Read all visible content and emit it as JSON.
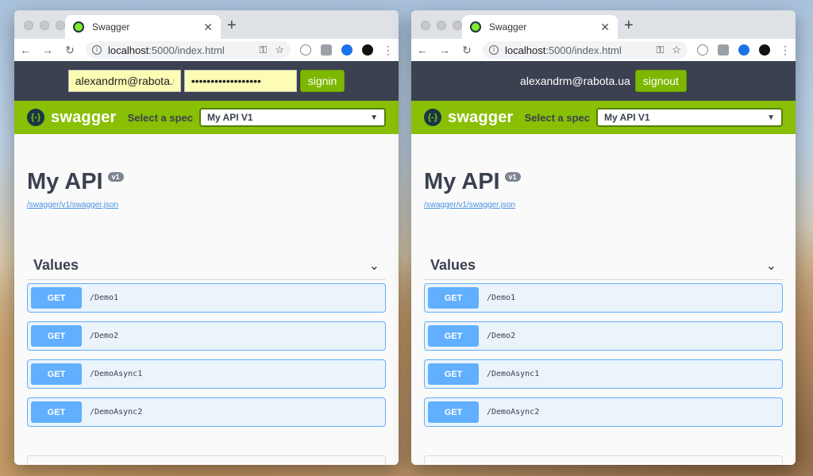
{
  "browser": {
    "tab_title": "Swagger",
    "tab_close": "✕",
    "new_tab": "+",
    "url_host": "localhost",
    "url_rest": ":5000/index.html"
  },
  "auth_left": {
    "email_value": "alexandrm@rabota.ua",
    "password_value": "••••••••••••••••••",
    "signin_label": "signin"
  },
  "auth_right": {
    "user_label": "alexandrm@rabota.ua",
    "signout_label": "signout"
  },
  "swagger": {
    "logo_text": "swagger",
    "logo_icon": "{-}",
    "select_label": "Select a spec",
    "selected_spec": "My API V1",
    "api_title": "My API",
    "version": "v1",
    "spec_link": "/swagger/v1/swagger.json",
    "tag": "Values",
    "operations": [
      {
        "method": "GET",
        "path": "/Demo1"
      },
      {
        "method": "GET",
        "path": "/Demo2"
      },
      {
        "method": "GET",
        "path": "/DemoAsync1"
      },
      {
        "method": "GET",
        "path": "/DemoAsync2"
      }
    ]
  },
  "colors": {
    "topbar": "#89bf04",
    "authbar": "#3b4151",
    "get_method": "#61affe",
    "signin_button": "#7db700"
  }
}
